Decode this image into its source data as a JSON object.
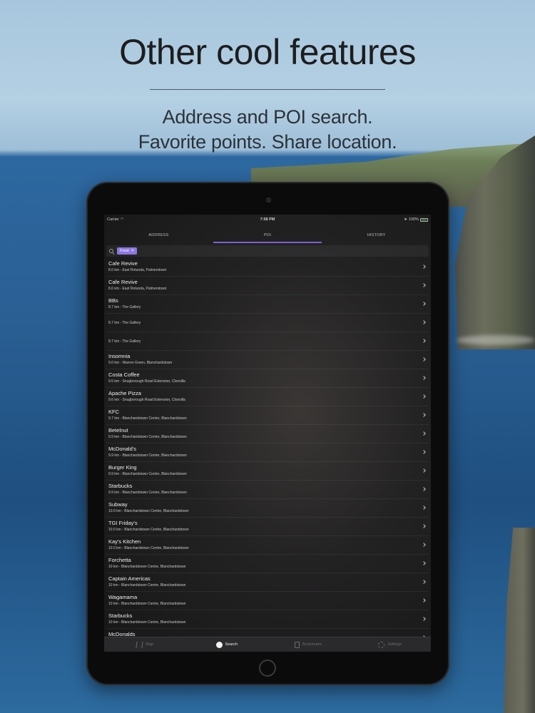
{
  "promo": {
    "headline": "Other cool features",
    "subline1": "Address and POI search.",
    "subline2": "Favorite points. Share location."
  },
  "statusbar": {
    "carrier": "Carrier",
    "time": "7:58 PM",
    "battery": "100%"
  },
  "top_tabs": [
    {
      "label": "ADDRESS",
      "active": false
    },
    {
      "label": "POI",
      "active": true
    },
    {
      "label": "HISTORY",
      "active": false
    }
  ],
  "search": {
    "chip_label": "Food",
    "chip_close": "✕"
  },
  "results": [
    {
      "name": "Cafe Revive",
      "addr": "8.6 km - East Rotunda, Palmerstown"
    },
    {
      "name": "Cafe Revive",
      "addr": "8.6 km - East Rotunda, Palmerstown"
    },
    {
      "name": "BBs",
      "addr": "8.7 km - The Gallery"
    },
    {
      "name": "",
      "addr": "8.7 km - The Gallery"
    },
    {
      "name": "",
      "addr": "8.7 km - The Gallery"
    },
    {
      "name": "Insomnia",
      "addr": "9.0 km - Warren Green, Blanchardstown"
    },
    {
      "name": "Costa Coffee",
      "addr": "9.5 km - Snugborough Road Extension, Clonsilla"
    },
    {
      "name": "Apache Pizza",
      "addr": "9.6 km - Snugborough Road Extension, Clonsilla"
    },
    {
      "name": "KFC",
      "addr": "9.7 km - Blanchardstown Centre, Blanchardstown"
    },
    {
      "name": "Betelnut",
      "addr": "9.9 km - Blanchardstown Centre, Blanchardstown"
    },
    {
      "name": "McDonald's",
      "addr": "9.9 km - Blanchardstown Centre, Blanchardstown"
    },
    {
      "name": "Burger King",
      "addr": "9.9 km - Blanchardstown Centre, Blanchardstown"
    },
    {
      "name": "Starbucks",
      "addr": "9.9 km - Blanchardstown Centre, Blanchardstown"
    },
    {
      "name": "Subway",
      "addr": "10.0 km - Blanchardstown Centre, Blanchardstown"
    },
    {
      "name": "TGI Friday's",
      "addr": "10.0 km - Blanchardstown Centre, Blanchardstown"
    },
    {
      "name": "Kay's Kitchen",
      "addr": "10.0 km - Blanchardstown Centre, Blanchardstown"
    },
    {
      "name": "Forchetta",
      "addr": "10 km - Blanchardstown Centre, Blanchardstown"
    },
    {
      "name": "Captain Americas",
      "addr": "10 km - Blanchardstown Centre, Blanchardstown"
    },
    {
      "name": "Wagamama",
      "addr": "10 km - Blanchardstown Centre, Blanchardstown"
    },
    {
      "name": "Starbucks",
      "addr": "10 km - Blanchardstown Centre, Blanchardstown"
    },
    {
      "name": "McDonalds",
      "addr": ""
    }
  ],
  "bottom_tabs": [
    {
      "label": "Map",
      "icon": "map-icon",
      "active": false
    },
    {
      "label": "Search",
      "icon": "search-icon",
      "active": true
    },
    {
      "label": "Bookmarks",
      "icon": "bookmark-icon",
      "active": false
    },
    {
      "label": "Settings",
      "icon": "gear-icon",
      "active": false
    }
  ],
  "colors": {
    "accent": "#7d62d6",
    "chip": "#8d77e0",
    "screen_bg": "#1e1e1f"
  }
}
